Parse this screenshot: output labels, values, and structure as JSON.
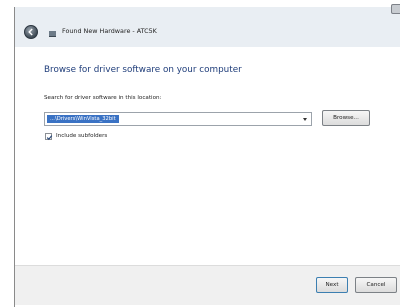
{
  "window": {
    "title": "Found New Hardware - ATC5K"
  },
  "page": {
    "heading": "Browse for driver software on your computer",
    "search_label": "Search for driver software in this location:",
    "search_value": "...\\Drivers\\WinVista_32bit",
    "browse_label": "Browse...",
    "include_subfolders_label": "Include subfolders",
    "include_subfolders_checked": true
  },
  "footer": {
    "next_label": "Next",
    "cancel_label": "Cancel"
  }
}
